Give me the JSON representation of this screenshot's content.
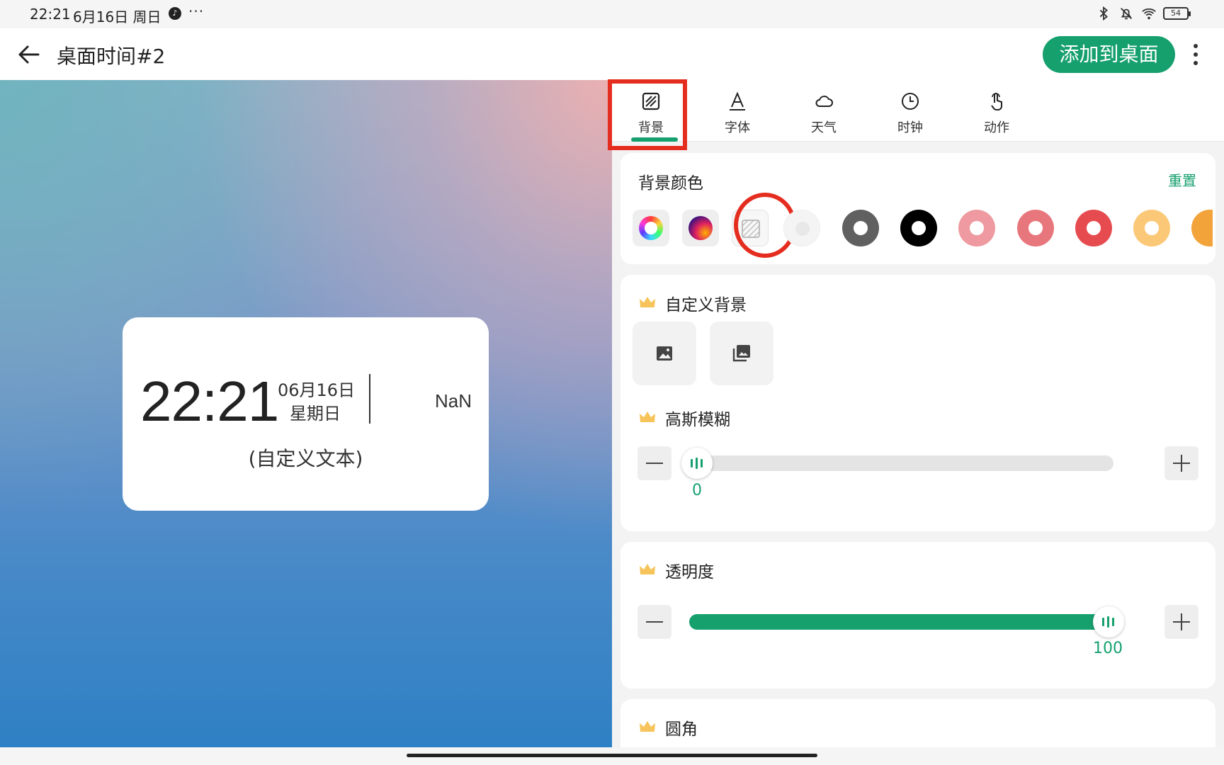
{
  "status_bar": {
    "time": "22:21",
    "date": "6月16日 周日",
    "more": "···",
    "battery": "54"
  },
  "app_bar": {
    "title": "桌面时间#2",
    "add_button": "添加到桌面"
  },
  "preview": {
    "time": "22:21",
    "date": "06月16日",
    "weekday": "星期日",
    "weather": "NaN",
    "custom_text": "(自定义文本)"
  },
  "tabs": [
    {
      "label": "背景",
      "icon": "background-icon",
      "active": true
    },
    {
      "label": "字体",
      "icon": "font-icon"
    },
    {
      "label": "天气",
      "icon": "cloud-icon"
    },
    {
      "label": "时钟",
      "icon": "clock-icon"
    },
    {
      "label": "动作",
      "icon": "tap-icon"
    }
  ],
  "background_color": {
    "title": "背景颜色",
    "reset": "重置",
    "swatches": [
      "#cccccc",
      "#606060",
      "#000000",
      "#ee9aa0",
      "#e8777d",
      "#e64b4f",
      "#fbc877",
      "#f2a33a"
    ]
  },
  "custom_background": {
    "title": "自定义背景"
  },
  "gaussian_blur": {
    "title": "高斯模糊",
    "value": "0"
  },
  "opacity": {
    "title": "透明度",
    "value": "100"
  },
  "corner_radius": {
    "title": "圆角"
  },
  "colors": {
    "accent": "#16a06e",
    "highlight": "#e52d1f"
  }
}
